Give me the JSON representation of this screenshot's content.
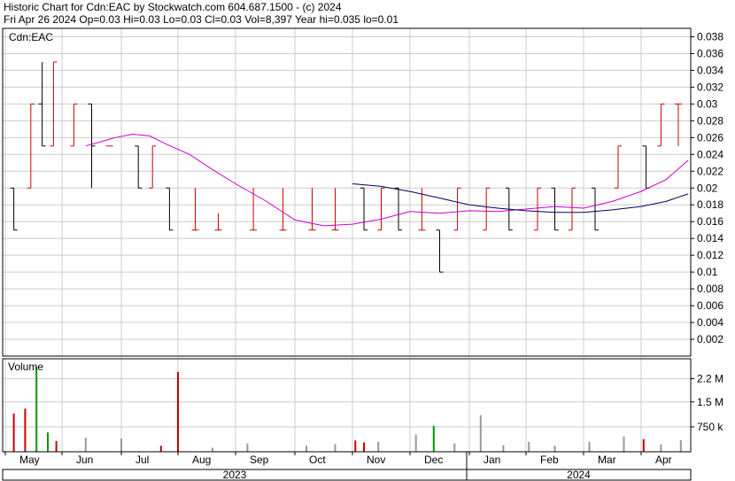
{
  "header": {
    "line1": "Historic Chart for Cdn:EAC by Stockwatch.com 604.687.1500 - (c) 2024",
    "line2": "Fri Apr 26 2024   Op=0.03   Hi=0.03   Lo=0.03   Cl=0.03   Vol=8,397   Year hi=0.035   lo=0.01"
  },
  "colors": {
    "up": "#cc0000",
    "down": "#000000",
    "ma_short": "#cc00cc",
    "ma_long": "#000066",
    "vol_up": "#cc0000",
    "vol_down": "#999999",
    "vol_flat": "#009900",
    "grid": "#cccccc"
  },
  "chart_data": [
    {
      "type": "line",
      "title": "Cdn:EAC",
      "y_ticks": [
        "0.038",
        "0.036",
        "0.034",
        "0.032",
        "0.03",
        "0.028",
        "0.026",
        "0.024",
        "0.022",
        "0.02",
        "0.018",
        "0.016",
        "0.014",
        "0.012",
        "0.01",
        "0.008",
        "0.006",
        "0.004",
        "0.002"
      ],
      "ylim": [
        0,
        0.039
      ],
      "price_bars": [
        {
          "month": "May",
          "x": 0.15,
          "hi": 0.02,
          "lo": 0.015,
          "op": 0.02,
          "cl": 0.015
        },
        {
          "month": "May",
          "x": 0.45,
          "hi": 0.03,
          "lo": 0.02,
          "op": 0.02,
          "cl": 0.03
        },
        {
          "month": "May",
          "x": 0.65,
          "hi": 0.035,
          "lo": 0.025,
          "op": 0.03,
          "cl": 0.025
        },
        {
          "month": "May",
          "x": 0.85,
          "hi": 0.035,
          "lo": 0.025,
          "op": 0.025,
          "cl": 0.035
        },
        {
          "month": "Jun",
          "x": 0.2,
          "hi": 0.03,
          "lo": 0.025,
          "op": 0.025,
          "cl": 0.03
        },
        {
          "month": "Jun",
          "x": 0.5,
          "hi": 0.03,
          "lo": 0.02,
          "op": 0.03,
          "cl": 0.025
        },
        {
          "month": "Jun",
          "x": 0.8,
          "hi": 0.025,
          "lo": 0.025,
          "op": 0.025,
          "cl": 0.025
        },
        {
          "month": "Jul",
          "x": 0.3,
          "hi": 0.025,
          "lo": 0.02,
          "op": 0.025,
          "cl": 0.02
        },
        {
          "month": "Jul",
          "x": 0.55,
          "hi": 0.025,
          "lo": 0.02,
          "op": 0.02,
          "cl": 0.025
        },
        {
          "month": "Jul",
          "x": 0.85,
          "hi": 0.02,
          "lo": 0.015,
          "op": 0.02,
          "cl": 0.015
        },
        {
          "month": "Aug",
          "x": 0.3,
          "hi": 0.02,
          "lo": 0.015,
          "op": 0.015,
          "cl": 0.015
        },
        {
          "month": "Aug",
          "x": 0.7,
          "hi": 0.017,
          "lo": 0.015,
          "op": 0.015,
          "cl": 0.015
        },
        {
          "month": "Sep",
          "x": 0.3,
          "hi": 0.02,
          "lo": 0.015,
          "op": 0.015,
          "cl": 0.015
        },
        {
          "month": "Sep",
          "x": 0.8,
          "hi": 0.02,
          "lo": 0.015,
          "op": 0.015,
          "cl": 0.015
        },
        {
          "month": "Oct",
          "x": 0.3,
          "hi": 0.02,
          "lo": 0.015,
          "op": 0.015,
          "cl": 0.015
        },
        {
          "month": "Oct",
          "x": 0.7,
          "hi": 0.02,
          "lo": 0.015,
          "op": 0.015,
          "cl": 0.015
        },
        {
          "month": "Nov",
          "x": 0.2,
          "hi": 0.02,
          "lo": 0.015,
          "op": 0.02,
          "cl": 0.015
        },
        {
          "month": "Nov",
          "x": 0.5,
          "hi": 0.02,
          "lo": 0.015,
          "op": 0.015,
          "cl": 0.02
        },
        {
          "month": "Nov",
          "x": 0.8,
          "hi": 0.02,
          "lo": 0.015,
          "op": 0.02,
          "cl": 0.015
        },
        {
          "month": "Dec",
          "x": 0.2,
          "hi": 0.02,
          "lo": 0.015,
          "op": 0.015,
          "cl": 0.015
        },
        {
          "month": "Dec",
          "x": 0.5,
          "hi": 0.015,
          "lo": 0.01,
          "op": 0.015,
          "cl": 0.01
        },
        {
          "month": "Dec",
          "x": 0.8,
          "hi": 0.02,
          "lo": 0.015,
          "op": 0.015,
          "cl": 0.02
        },
        {
          "month": "Jan",
          "x": 0.3,
          "hi": 0.02,
          "lo": 0.015,
          "op": 0.015,
          "cl": 0.02
        },
        {
          "month": "Jan",
          "x": 0.7,
          "hi": 0.02,
          "lo": 0.015,
          "op": 0.02,
          "cl": 0.015
        },
        {
          "month": "Feb",
          "x": 0.2,
          "hi": 0.02,
          "lo": 0.015,
          "op": 0.015,
          "cl": 0.02
        },
        {
          "month": "Feb",
          "x": 0.5,
          "hi": 0.02,
          "lo": 0.015,
          "op": 0.02,
          "cl": 0.015
        },
        {
          "month": "Feb",
          "x": 0.8,
          "hi": 0.02,
          "lo": 0.015,
          "op": 0.015,
          "cl": 0.02
        },
        {
          "month": "Mar",
          "x": 0.2,
          "hi": 0.02,
          "lo": 0.015,
          "op": 0.02,
          "cl": 0.015
        },
        {
          "month": "Mar",
          "x": 0.6,
          "hi": 0.025,
          "lo": 0.02,
          "op": 0.02,
          "cl": 0.025
        },
        {
          "month": "Apr",
          "x": 0.1,
          "hi": 0.025,
          "lo": 0.02,
          "op": 0.025,
          "cl": 0.02
        },
        {
          "month": "Apr",
          "x": 0.4,
          "hi": 0.03,
          "lo": 0.025,
          "op": 0.025,
          "cl": 0.03
        },
        {
          "month": "Apr",
          "x": 0.75,
          "hi": 0.03,
          "lo": 0.025,
          "op": 0.03,
          "cl": 0.03
        }
      ],
      "ma_short": [
        {
          "month": "Jun",
          "x": 0.4,
          "y": 0.025
        },
        {
          "month": "Jun",
          "x": 0.9,
          "y": 0.026
        },
        {
          "month": "Jul",
          "x": 0.2,
          "y": 0.0264
        },
        {
          "month": "Jul",
          "x": 0.5,
          "y": 0.0262
        },
        {
          "month": "Jul",
          "x": 0.8,
          "y": 0.0252
        },
        {
          "month": "Aug",
          "x": 0.2,
          "y": 0.024
        },
        {
          "month": "Aug",
          "x": 0.6,
          "y": 0.0222
        },
        {
          "month": "Sep",
          "x": 0.0,
          "y": 0.0205
        },
        {
          "month": "Sep",
          "x": 0.5,
          "y": 0.0185
        },
        {
          "month": "Oct",
          "x": 0.0,
          "y": 0.0162
        },
        {
          "month": "Oct",
          "x": 0.5,
          "y": 0.0155
        },
        {
          "month": "Nov",
          "x": 0.0,
          "y": 0.0157
        },
        {
          "month": "Nov",
          "x": 0.5,
          "y": 0.0163
        },
        {
          "month": "Dec",
          "x": 0.0,
          "y": 0.0172
        },
        {
          "month": "Dec",
          "x": 0.5,
          "y": 0.017
        },
        {
          "month": "Jan",
          "x": 0.0,
          "y": 0.0173
        },
        {
          "month": "Jan",
          "x": 0.5,
          "y": 0.0172
        },
        {
          "month": "Feb",
          "x": 0.0,
          "y": 0.0175
        },
        {
          "month": "Feb",
          "x": 0.5,
          "y": 0.0178
        },
        {
          "month": "Mar",
          "x": 0.0,
          "y": 0.0176
        },
        {
          "month": "Mar",
          "x": 0.5,
          "y": 0.0184
        },
        {
          "month": "Apr",
          "x": 0.0,
          "y": 0.0196
        },
        {
          "month": "Apr",
          "x": 0.5,
          "y": 0.021
        },
        {
          "month": "Apr",
          "x": 0.95,
          "y": 0.0233
        }
      ],
      "ma_long": [
        {
          "month": "Nov",
          "x": 0.0,
          "y": 0.0205
        },
        {
          "month": "Nov",
          "x": 0.5,
          "y": 0.0202
        },
        {
          "month": "Dec",
          "x": 0.0,
          "y": 0.0196
        },
        {
          "month": "Dec",
          "x": 0.5,
          "y": 0.0188
        },
        {
          "month": "Jan",
          "x": 0.0,
          "y": 0.018
        },
        {
          "month": "Jan",
          "x": 0.5,
          "y": 0.0176
        },
        {
          "month": "Feb",
          "x": 0.0,
          "y": 0.0173
        },
        {
          "month": "Feb",
          "x": 0.5,
          "y": 0.0171
        },
        {
          "month": "Mar",
          "x": 0.0,
          "y": 0.0171
        },
        {
          "month": "Mar",
          "x": 0.5,
          "y": 0.0174
        },
        {
          "month": "Apr",
          "x": 0.0,
          "y": 0.0178
        },
        {
          "month": "Apr",
          "x": 0.5,
          "y": 0.0184
        },
        {
          "month": "Apr",
          "x": 0.95,
          "y": 0.0193
        }
      ]
    },
    {
      "type": "bar",
      "title": "Volume",
      "y_ticks": [
        {
          "label": "2.2 M",
          "value": 2200000
        },
        {
          "label": "1.5 M",
          "value": 1500000
        },
        {
          "label": "750 k",
          "value": 750000
        }
      ],
      "ylim": [
        0,
        2800000
      ],
      "bars": [
        {
          "month": "May",
          "x": 0.15,
          "v": 1150000,
          "dir": "up"
        },
        {
          "month": "May",
          "x": 0.35,
          "v": 1300000,
          "dir": "up"
        },
        {
          "month": "May",
          "x": 0.55,
          "v": 2560000,
          "dir": "flat"
        },
        {
          "month": "May",
          "x": 0.75,
          "v": 580000,
          "dir": "flat"
        },
        {
          "month": "May",
          "x": 0.9,
          "v": 320000,
          "dir": "up"
        },
        {
          "month": "Jun",
          "x": 0.4,
          "v": 420000,
          "dir": "down"
        },
        {
          "month": "Jul",
          "x": 0.0,
          "v": 400000,
          "dir": "down"
        },
        {
          "month": "Jul",
          "x": 0.7,
          "v": 180000,
          "dir": "up"
        },
        {
          "month": "Aug",
          "x": 0.0,
          "v": 2400000,
          "dir": "up"
        },
        {
          "month": "Aug",
          "x": 0.6,
          "v": 120000,
          "dir": "down"
        },
        {
          "month": "Sep",
          "x": 0.2,
          "v": 250000,
          "dir": "down"
        },
        {
          "month": "Oct",
          "x": 0.2,
          "v": 180000,
          "dir": "down"
        },
        {
          "month": "Oct",
          "x": 0.7,
          "v": 230000,
          "dir": "down"
        },
        {
          "month": "Nov",
          "x": 0.05,
          "v": 340000,
          "dir": "up"
        },
        {
          "month": "Nov",
          "x": 0.2,
          "v": 280000,
          "dir": "up"
        },
        {
          "month": "Nov",
          "x": 0.45,
          "v": 300000,
          "dir": "down"
        },
        {
          "month": "Dec",
          "x": 0.1,
          "v": 520000,
          "dir": "down"
        },
        {
          "month": "Dec",
          "x": 0.4,
          "v": 780000,
          "dir": "flat"
        },
        {
          "month": "Dec",
          "x": 0.75,
          "v": 250000,
          "dir": "down"
        },
        {
          "month": "Jan",
          "x": 0.2,
          "v": 1100000,
          "dir": "down"
        },
        {
          "month": "Jan",
          "x": 0.6,
          "v": 200000,
          "dir": "down"
        },
        {
          "month": "Feb",
          "x": 0.05,
          "v": 300000,
          "dir": "down"
        },
        {
          "month": "Feb",
          "x": 0.5,
          "v": 180000,
          "dir": "down"
        },
        {
          "month": "Mar",
          "x": 0.1,
          "v": 300000,
          "dir": "down"
        },
        {
          "month": "Mar",
          "x": 0.7,
          "v": 460000,
          "dir": "down"
        },
        {
          "month": "Apr",
          "x": 0.05,
          "v": 380000,
          "dir": "up"
        },
        {
          "month": "Apr",
          "x": 0.4,
          "v": 220000,
          "dir": "down"
        },
        {
          "month": "Apr",
          "x": 0.8,
          "v": 350000,
          "dir": "down"
        }
      ]
    }
  ],
  "x_axis": {
    "months": [
      "May",
      "Jun",
      "Jul",
      "Aug",
      "Sep",
      "Oct",
      "Nov",
      "Dec",
      "Jan",
      "Feb",
      "Mar",
      "Apr"
    ],
    "years": [
      "2023",
      "2024"
    ]
  }
}
